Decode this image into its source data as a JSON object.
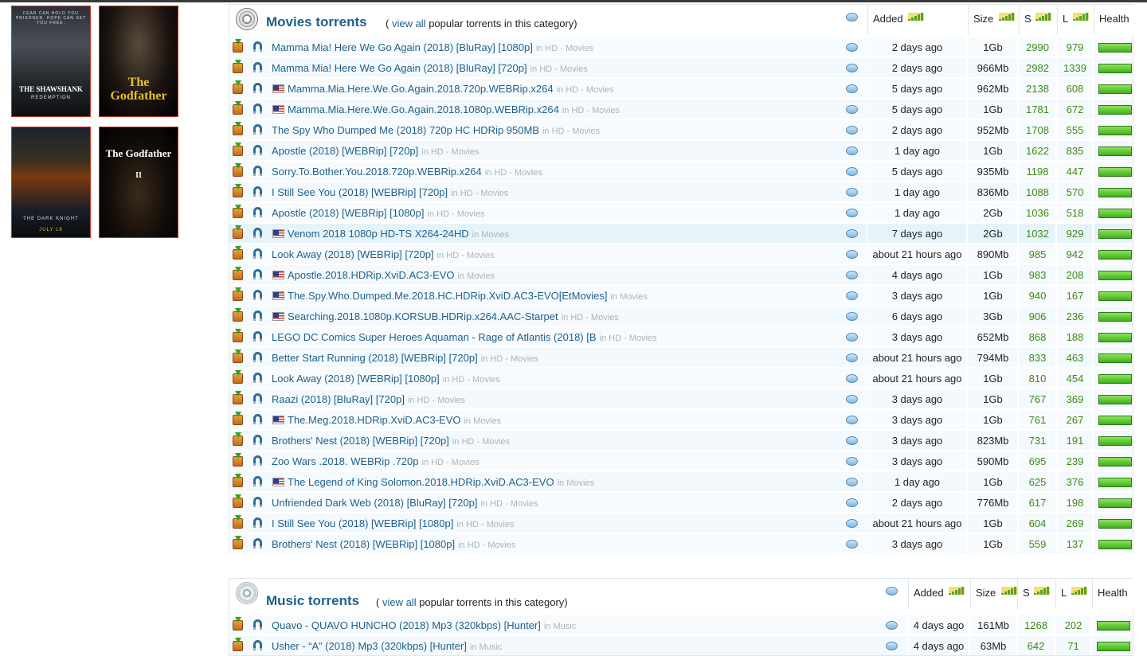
{
  "posters": [
    {
      "title": "THE SHAWSHANK",
      "sub": "REDEMPTION",
      "tagline": "FEAR CAN HOLD YOU PRISONER. HOPE CAN SET YOU FREE."
    },
    {
      "title": "The Godfather",
      "sub": ""
    },
    {
      "title": "",
      "sub": "THE DARK KNIGHT",
      "tagline": "JULY 18"
    },
    {
      "title": "The Godfather",
      "sub": "II"
    }
  ],
  "movies": {
    "title": "Movies torrents",
    "view_all": "view all",
    "sub_prefix": "( ",
    "sub_suffix": " popular torrents in this category)",
    "headers": {
      "added": "Added",
      "size": "Size",
      "s": "S",
      "l": "L",
      "health": "Health"
    },
    "rows": [
      {
        "name": "Mamma Mia! Here We Go Again (2018) [BluRay] [1080p]",
        "cat": "in HD - Movies",
        "flag": false,
        "added": "2 days ago",
        "size": "1Gb",
        "s": "2990",
        "l": "979"
      },
      {
        "name": "Mamma Mia! Here We Go Again (2018) [BluRay] [720p]",
        "cat": "in HD - Movies",
        "flag": false,
        "added": "2 days ago",
        "size": "966Mb",
        "s": "2982",
        "l": "1339"
      },
      {
        "name": "Mamma.Mia.Here.We.Go.Again.2018.720p.WEBRip.x264",
        "cat": "in HD - Movies",
        "flag": true,
        "added": "5 days ago",
        "size": "962Mb",
        "s": "2138",
        "l": "608"
      },
      {
        "name": "Mamma.Mia.Here.We.Go.Again.2018.1080p.WEBRip.x264",
        "cat": "in HD - Movies",
        "flag": true,
        "added": "5 days ago",
        "size": "1Gb",
        "s": "1781",
        "l": "672"
      },
      {
        "name": "The Spy Who Dumped Me (2018) 720p HC HDRip 950MB",
        "cat": "in HD - Movies",
        "flag": false,
        "added": "2 days ago",
        "size": "952Mb",
        "s": "1708",
        "l": "555"
      },
      {
        "name": "Apostle (2018) [WEBRip] [720p]",
        "cat": "in HD - Movies",
        "flag": false,
        "added": "1 day ago",
        "size": "1Gb",
        "s": "1622",
        "l": "835"
      },
      {
        "name": "Sorry.To.Bother.You.2018.720p.WEBRip.x264",
        "cat": "in HD - Movies",
        "flag": false,
        "added": "5 days ago",
        "size": "935Mb",
        "s": "1198",
        "l": "447"
      },
      {
        "name": "I Still See You (2018) [WEBRip] [720p]",
        "cat": "in HD - Movies",
        "flag": false,
        "added": "1 day ago",
        "size": "836Mb",
        "s": "1088",
        "l": "570"
      },
      {
        "name": "Apostle (2018) [WEBRip] [1080p]",
        "cat": "in HD - Movies",
        "flag": false,
        "added": "1 day ago",
        "size": "2Gb",
        "s": "1036",
        "l": "518"
      },
      {
        "name": "Venom 2018 1080p HD-TS X264-24HD",
        "cat": "in Movies",
        "flag": true,
        "added": "7 days ago",
        "size": "2Gb",
        "s": "1032",
        "l": "929"
      },
      {
        "name": "Look Away (2018) [WEBRip] [720p]",
        "cat": "in HD - Movies",
        "flag": false,
        "added": "about 21 hours ago",
        "size": "890Mb",
        "s": "985",
        "l": "942"
      },
      {
        "name": "Apostle.2018.HDRip.XviD.AC3-EVO",
        "cat": "in Movies",
        "flag": true,
        "added": "4 days ago",
        "size": "1Gb",
        "s": "983",
        "l": "208"
      },
      {
        "name": "The.Spy.Who.Dumped.Me.2018.HC.HDRip.XviD.AC3-EVO[EtMovies]",
        "cat": "in Movies",
        "flag": true,
        "added": "3 days ago",
        "size": "1Gb",
        "s": "940",
        "l": "167"
      },
      {
        "name": "Searching.2018.1080p.KORSUB.HDRip.x264.AAC-Starpet",
        "cat": "in HD - Movies",
        "flag": true,
        "added": "6 days ago",
        "size": "3Gb",
        "s": "906",
        "l": "236"
      },
      {
        "name": "LEGO DC Comics Super Heroes Aquaman - Rage of Atlantis (2018) [B",
        "cat": "in HD - Movies",
        "flag": false,
        "added": "3 days ago",
        "size": "652Mb",
        "s": "868",
        "l": "188"
      },
      {
        "name": "Better Start Running (2018) [WEBRip] [720p]",
        "cat": "in HD - Movies",
        "flag": false,
        "added": "about 21 hours ago",
        "size": "794Mb",
        "s": "833",
        "l": "463"
      },
      {
        "name": "Look Away (2018) [WEBRip] [1080p]",
        "cat": "in HD - Movies",
        "flag": false,
        "added": "about 21 hours ago",
        "size": "1Gb",
        "s": "810",
        "l": "454"
      },
      {
        "name": "Raazi (2018) [BluRay] [720p]",
        "cat": "in HD - Movies",
        "flag": false,
        "added": "3 days ago",
        "size": "1Gb",
        "s": "767",
        "l": "369"
      },
      {
        "name": "The.Meg.2018.HDRip.XviD.AC3-EVO",
        "cat": "in Movies",
        "flag": true,
        "added": "3 days ago",
        "size": "1Gb",
        "s": "761",
        "l": "267"
      },
      {
        "name": "Brothers' Nest (2018) [WEBRip] [720p]",
        "cat": "in HD - Movies",
        "flag": false,
        "added": "3 days ago",
        "size": "823Mb",
        "s": "731",
        "l": "191"
      },
      {
        "name": "Zoo Wars .2018. WEBRip .720p",
        "cat": "in HD - Movies",
        "flag": false,
        "added": "3 days ago",
        "size": "590Mb",
        "s": "695",
        "l": "239"
      },
      {
        "name": "The Legend of King Solomon.2018.HDRip.XviD.AC3-EVO",
        "cat": "in Movies",
        "flag": true,
        "added": "1 day ago",
        "size": "1Gb",
        "s": "625",
        "l": "376"
      },
      {
        "name": "Unfriended Dark Web (2018) [BluRay] [720p]",
        "cat": "in HD - Movies",
        "flag": false,
        "added": "2 days ago",
        "size": "776Mb",
        "s": "617",
        "l": "198"
      },
      {
        "name": "I Still See You (2018) [WEBRip] [1080p]",
        "cat": "in HD - Movies",
        "flag": false,
        "added": "about 21 hours ago",
        "size": "1Gb",
        "s": "604",
        "l": "269"
      },
      {
        "name": "Brothers' Nest (2018) [WEBRip] [1080p]",
        "cat": "in HD - Movies",
        "flag": false,
        "added": "3 days ago",
        "size": "1Gb",
        "s": "559",
        "l": "137"
      }
    ]
  },
  "music": {
    "title": "Music torrents",
    "view_all": "view all",
    "sub_prefix": "( ",
    "sub_suffix": " popular torrents in this category)",
    "headers": {
      "added": "Added",
      "size": "Size",
      "s": "S",
      "l": "L",
      "health": "Health"
    },
    "rows": [
      {
        "name": "Quavo - QUAVO HUNCHO (2018) Mp3 (320kbps) [Hunter]",
        "cat": "in Music",
        "flag": false,
        "added": "4 days ago",
        "size": "161Mb",
        "s": "1268",
        "l": "202"
      },
      {
        "name": "Usher - “A” (2018) Mp3 (320kbps) [Hunter]",
        "cat": "in Music",
        "flag": false,
        "added": "4 days ago",
        "size": "63Mb",
        "s": "642",
        "l": "71"
      }
    ]
  },
  "colors": {
    "link": "#1f5f8b",
    "seed": "#3d8a14",
    "health": "#3fb01c"
  }
}
